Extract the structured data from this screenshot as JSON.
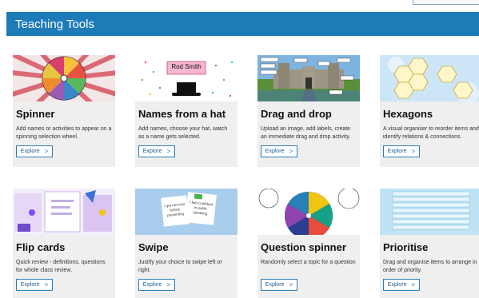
{
  "header": {
    "title": "Teaching Tools"
  },
  "cards": [
    {
      "title": "Spinner",
      "description": "Add names or activities to appear on a spinning selection wheel.",
      "button": "Explore",
      "thumb": "spinner-wheel-image"
    },
    {
      "title": "Names from a hat",
      "description": "Add names, choose your hat, watch as a name gets selected.",
      "button": "Explore",
      "thumb": "top-hat-image",
      "thumb_text": "Rod Smith"
    },
    {
      "title": "Drag and drop",
      "description": "Upload an image, add labels, create an immediate drag and drop activity.",
      "button": "Explore",
      "thumb": "castle-image"
    },
    {
      "title": "Hexagons",
      "description": "A visual organiser to reorder items and identify relations & connections.",
      "button": "Explore",
      "thumb": "hexagons-image"
    },
    {
      "title": "Flip cards",
      "description": "Quick review - definitions, questions for whole class review.",
      "button": "Explore",
      "thumb": "flip-cards-image"
    },
    {
      "title": "Swipe",
      "description": "Justify your choice to swipe left or right.",
      "button": "Explore",
      "thumb": "swipe-cards-image",
      "thumb_text_left": "I get nervous before presenting",
      "thumb_text_right": "I feel confident in public speaking"
    },
    {
      "title": "Question spinner",
      "description": "Randomly select a topic for a question",
      "button": "Explore",
      "thumb": "question-wheel-image"
    },
    {
      "title": "Prioritise",
      "description": "Drag and organise items to arrange in order of priority.",
      "button": "Explore",
      "thumb": "prioritise-list-image"
    }
  ]
}
